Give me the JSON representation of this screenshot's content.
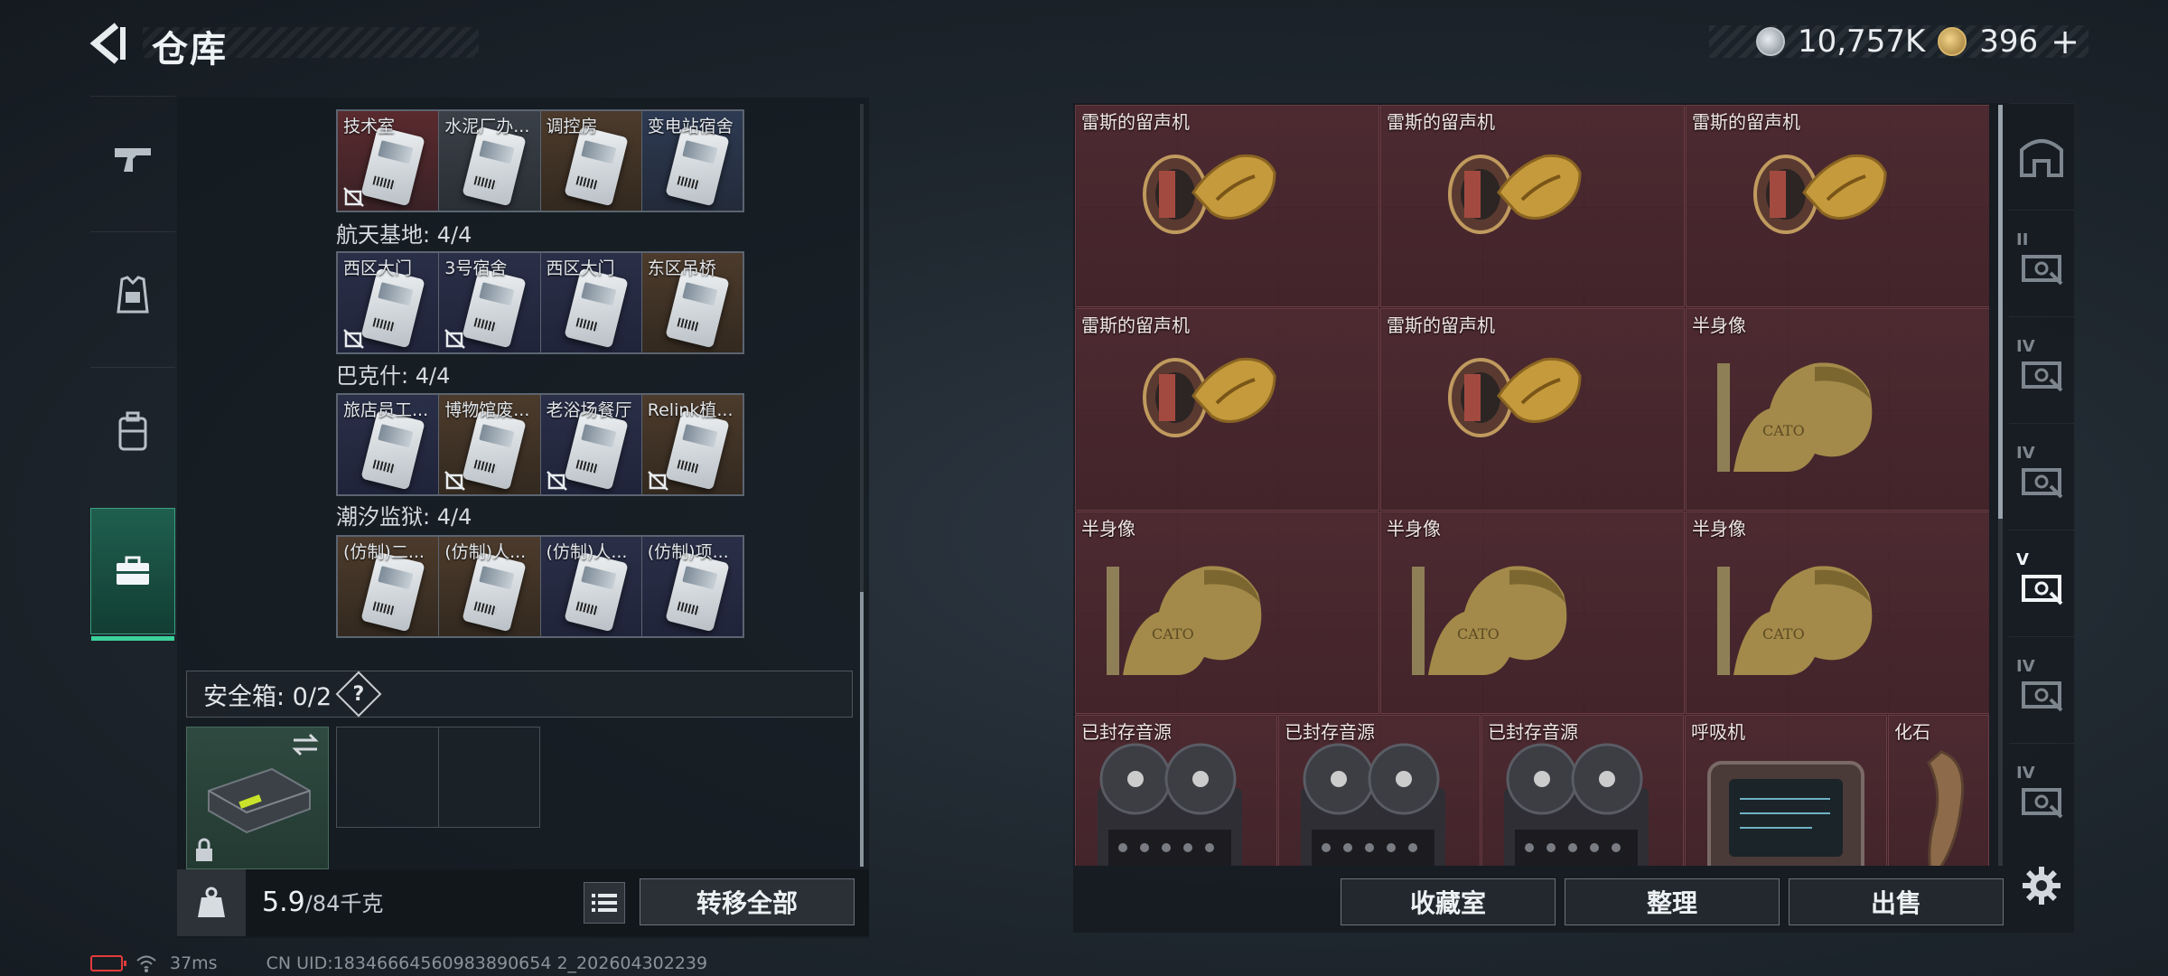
{
  "header": {
    "title": "仓库",
    "currency": {
      "silver": "10,757K",
      "gold": "396",
      "add": "+"
    }
  },
  "left_nav": [
    "weapon-icon",
    "armor-icon",
    "backpack-icon",
    "toolbox-icon"
  ],
  "groups": [
    {
      "name": "",
      "items": [
        {
          "label": "技术室",
          "bg": "red",
          "locked": true
        },
        {
          "label": "水泥厂办...",
          "bg": "gray",
          "locked": false
        },
        {
          "label": "调控房",
          "bg": "brown",
          "locked": false
        },
        {
          "label": "变电站宿舍",
          "bg": "blue",
          "locked": false
        }
      ]
    },
    {
      "name": "航天基地: 4/4",
      "items": [
        {
          "label": "西区大门",
          "bg": "navy",
          "locked": true
        },
        {
          "label": "3号宿舍",
          "bg": "navy",
          "locked": true
        },
        {
          "label": "西区大门",
          "bg": "navy",
          "locked": false
        },
        {
          "label": "东区吊桥",
          "bg": "brown",
          "locked": false
        }
      ]
    },
    {
      "name": "巴克什: 4/4",
      "items": [
        {
          "label": "旅店员工...",
          "bg": "navy",
          "locked": false
        },
        {
          "label": "博物馆废...",
          "bg": "brown",
          "locked": true
        },
        {
          "label": "老浴场餐厅",
          "bg": "navy",
          "locked": true
        },
        {
          "label": "Relink植...",
          "bg": "brown",
          "locked": true
        }
      ]
    },
    {
      "name": "潮汐监狱: 4/4",
      "items": [
        {
          "label": "(仿制)二...",
          "bg": "brown",
          "locked": false
        },
        {
          "label": "(仿制)人...",
          "bg": "brown",
          "locked": false
        },
        {
          "label": "(仿制)人...",
          "bg": "navy",
          "locked": false
        },
        {
          "label": "(仿制)项...",
          "bg": "navy",
          "locked": false
        }
      ]
    }
  ],
  "safebox": {
    "label": "安全箱: 0/2",
    "help": "?"
  },
  "bottom_left": {
    "weight_value": "5.9",
    "weight_max": "/84千克",
    "transfer_all": "转移全部"
  },
  "items": [
    {
      "label": "雷斯的留声机",
      "icon": "gramophone"
    },
    {
      "label": "雷斯的留声机",
      "icon": "gramophone"
    },
    {
      "label": "雷斯的留声机",
      "icon": "gramophone"
    },
    {
      "label": "雷斯的留声机",
      "icon": "gramophone"
    },
    {
      "label": "雷斯的留声机",
      "icon": "gramophone"
    },
    {
      "label": "半身像",
      "icon": "bust"
    },
    {
      "label": "半身像",
      "icon": "bust"
    },
    {
      "label": "半身像",
      "icon": "bust"
    },
    {
      "label": "半身像",
      "icon": "bust"
    },
    {
      "label": "已封存音源",
      "icon": "tape-recorder"
    },
    {
      "label": "已封存音源",
      "icon": "tape-recorder"
    },
    {
      "label": "已封存音源",
      "icon": "tape-recorder"
    },
    {
      "label": "呼吸机",
      "icon": "ventilator"
    },
    {
      "label": "化石",
      "icon": "fossil"
    }
  ],
  "bust_inscription": "CATO",
  "right_buttons": {
    "collection": "收藏室",
    "organize": "整理",
    "sell": "出售"
  },
  "right_nav": [
    "base-icon",
    "case-II-icon",
    "case-IV-icon",
    "case-IV-icon",
    "case-V-icon",
    "case-IV-icon",
    "case-IV-icon"
  ],
  "right_nav_labels": [
    "",
    "II",
    "IV",
    "IV",
    "V",
    "IV",
    "IV"
  ],
  "status": {
    "ping": "37ms",
    "uid": "CN UID:18346664560983890654 2_202604302239"
  }
}
